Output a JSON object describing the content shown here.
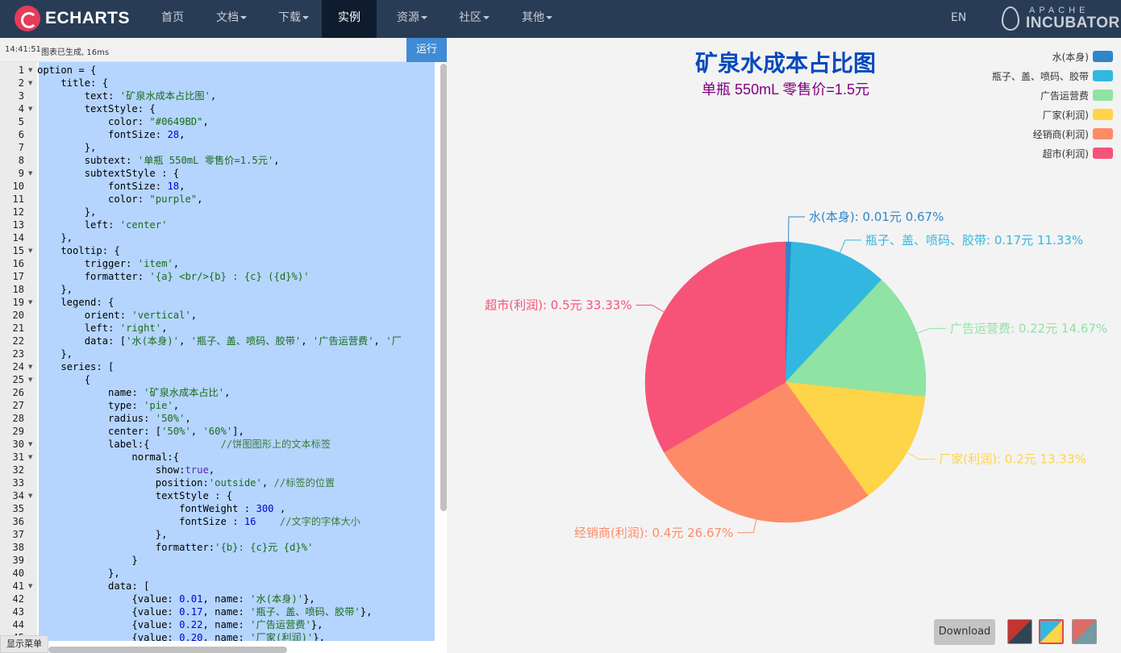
{
  "nav": {
    "logo_text": "ECHARTS",
    "items": [
      {
        "label": "首页",
        "caret": false
      },
      {
        "label": "文档",
        "caret": true
      },
      {
        "label": "下载",
        "caret": true
      },
      {
        "label": "实例",
        "caret": false
      },
      {
        "label": "资源",
        "caret": true
      },
      {
        "label": "社区",
        "caret": true
      },
      {
        "label": "其他",
        "caret": true
      }
    ],
    "lang": "EN",
    "incubator_top": "APACHE",
    "incubator_word": "INCUBATOR"
  },
  "editor": {
    "status_time": "14:41:51",
    "status_msg": "图表已生成, 16ms",
    "run_label": "运行",
    "show_menu_label": "显示菜单",
    "lines": [
      "option = {",
      "    title: {",
      "        text: '矿泉水成本占比图',",
      "        textStyle: {",
      "            color: \"#0649BD\",",
      "            fontSize: 28,",
      "        },",
      "        subtext: '单瓶 550mL 零售价=1.5元',",
      "        subtextStyle : {",
      "            fontSize: 18,",
      "            color: \"purple\",",
      "        },",
      "        left: 'center'",
      "    },",
      "    tooltip: {",
      "        trigger: 'item',",
      "        formatter: '{a} <br/>{b} : {c} ({d}%)'",
      "    },",
      "    legend: {",
      "        orient: 'vertical',",
      "        left: 'right',",
      "        data: ['水(本身)', '瓶子、盖、喷码、胶带', '广告运营费', '厂",
      "    },",
      "    series: [",
      "        {",
      "            name: '矿泉水成本占比',",
      "            type: 'pie',",
      "            radius: '50%',",
      "            center: ['50%', '60%'],",
      "            label:{            //饼图图形上的文本标签",
      "                normal:{",
      "                    show:true,",
      "                    position:'outside', //标签的位置",
      "                    textStyle : {",
      "                        fontWeight : 300 ,",
      "                        fontSize : 16    //文字的字体大小",
      "                    },",
      "                    formatter:'{b}: {c}元 {d}%'",
      "                }",
      "            },",
      "            data: [",
      "                {value: 0.01, name: '水(本身)'},",
      "                {value: 0.17, name: '瓶子、盖、喷码、胶带'},",
      "                {value: 0.22, name: '广告运营费'},",
      "                {value: 0.20, name: '厂家(利润)'},"
    ],
    "fold_lines": [
      1,
      2,
      4,
      9,
      15,
      19,
      24,
      25,
      30,
      31,
      34,
      41
    ]
  },
  "chart_data": {
    "type": "pie",
    "title": "矿泉水成本占比图",
    "subtitle": "单瓶 550mL 零售价=1.5元",
    "legend_position": "top-right",
    "slices": [
      {
        "name": "水(本身)",
        "value": 0.01,
        "percent": 0.67,
        "label": "水(本身): 0.01元 0.67%",
        "color": "#2e86c9"
      },
      {
        "name": "瓶子、盖、喷码、胶带",
        "value": 0.17,
        "percent": 11.33,
        "label": "瓶子、盖、喷码、胶带: 0.17元 11.33%",
        "color": "#32b8e0"
      },
      {
        "name": "广告运营费",
        "value": 0.22,
        "percent": 14.67,
        "label": "广告运营费: 0.22元 14.67%",
        "color": "#8fe3a3"
      },
      {
        "name": "厂家(利润)",
        "value": 0.2,
        "percent": 13.33,
        "label": "厂家(利润): 0.2元 13.33%",
        "color": "#fed448"
      },
      {
        "name": "经销商(利润)",
        "value": 0.4,
        "percent": 26.67,
        "label": "经销商(利润): 0.4元 26.67%",
        "color": "#fe8b67"
      },
      {
        "name": "超市(利润)",
        "value": 0.5,
        "percent": 33.33,
        "label": "超市(利润): 0.5元 33.33%",
        "color": "#f75378"
      }
    ]
  },
  "toolbar": {
    "download_label": "Download"
  }
}
